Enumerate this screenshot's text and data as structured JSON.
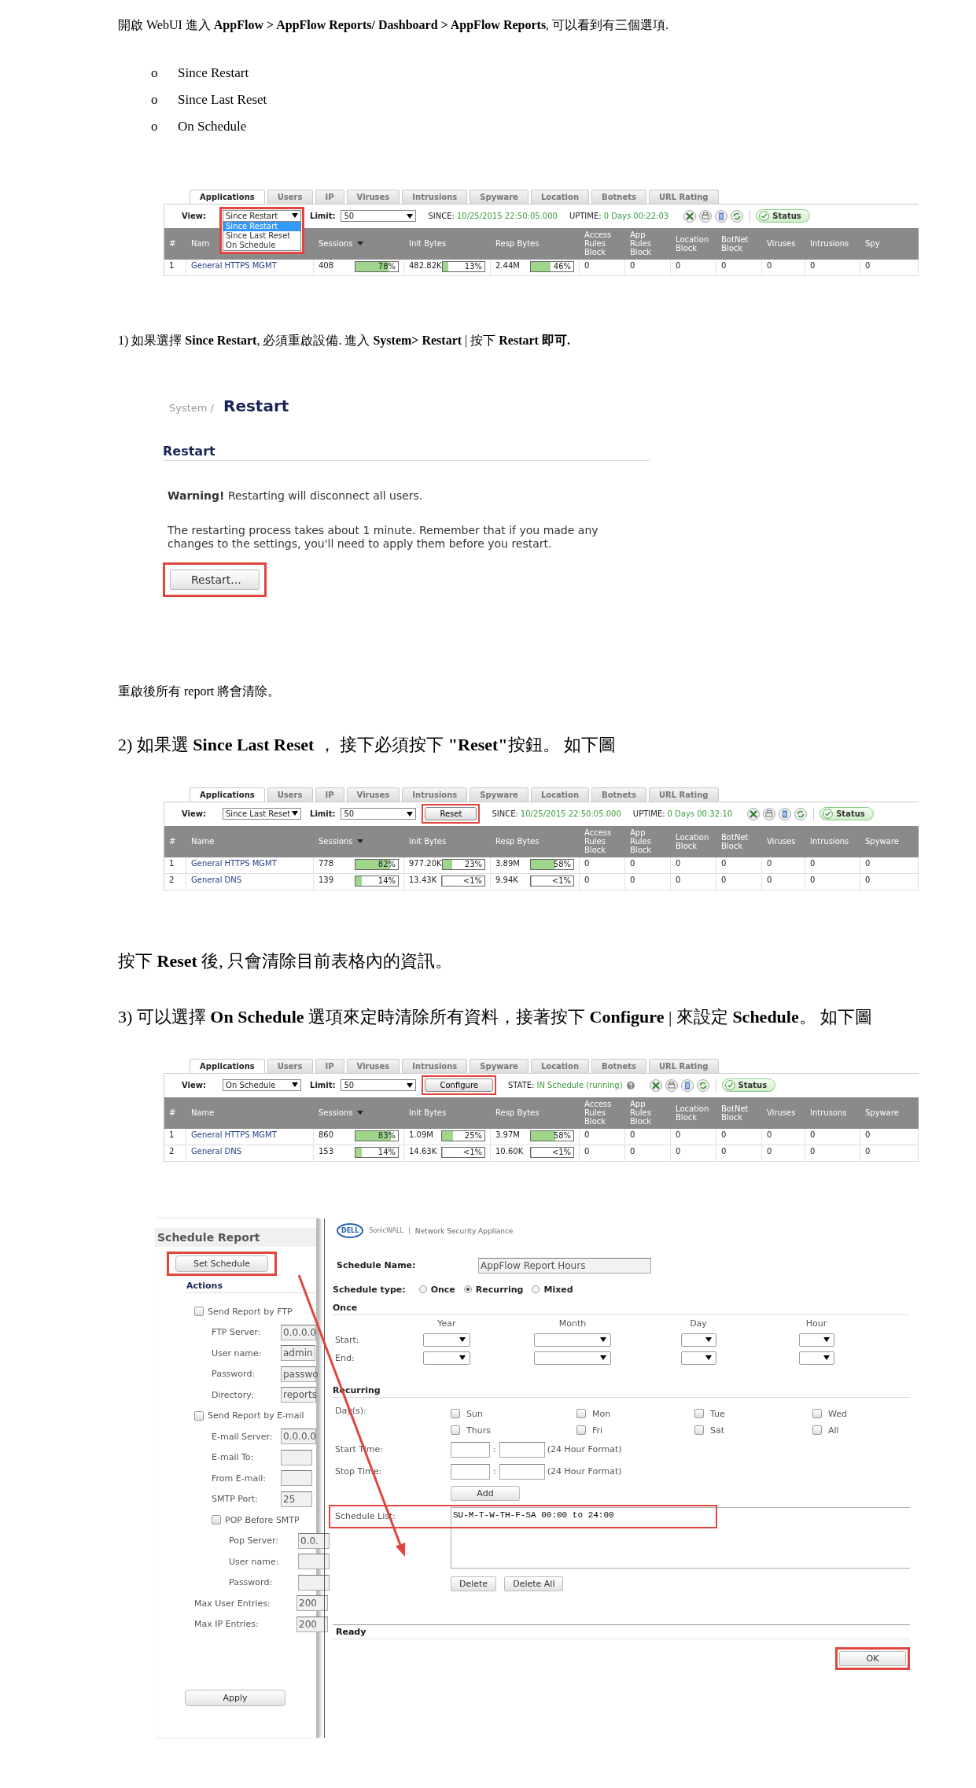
{
  "sections": [
    {
      "kind": "note",
      "text": "開啟 WebUI 進入 **AppFlow > AppFlow Reports/ Dashboard > AppFlow Reports**, 可以看到有三個選項."
    },
    {
      "kind": "bullets",
      "items": [
        {
          "marker": "o",
          "text": "Since Restart"
        },
        {
          "marker": "o",
          "text": "Since Last Reset"
        },
        {
          "marker": "o",
          "text": "On Schedule"
        }
      ]
    },
    {
      "kind": "report",
      "tabs": [
        {
          "label": "Applications",
          "selected": true
        },
        {
          "label": "Users",
          "selected": false
        },
        {
          "label": "IP",
          "selected": false
        },
        {
          "label": "Viruses",
          "selected": false
        },
        {
          "label": "Intrusions",
          "selected": false
        },
        {
          "label": "Spyware",
          "selected": false
        },
        {
          "label": "Location",
          "selected": false
        },
        {
          "label": "Botnets",
          "selected": false
        },
        {
          "label": "URL Rating",
          "selected": false
        }
      ],
      "view_label": "View:",
      "view_value": "Since Restart",
      "dropdown_open": true,
      "view_highlighted": true,
      "action_highlighted": false,
      "options": [
        {
          "label": "Since Restart",
          "selected": true
        },
        {
          "label": "Since Last Reset",
          "selected": false
        },
        {
          "label": "On Schedule",
          "selected": false
        }
      ],
      "limit_label": "Limit:",
      "limit_value": "50",
      "has_help": false,
      "status": [
        {
          "label": "SINCE:",
          "value": "10/25/2015 22:50:05.000"
        },
        {
          "label": "UPTIME:",
          "value": "0 Days 00:22:03"
        }
      ],
      "status_button": "Status",
      "columns": [
        "#",
        "Nam",
        "Sessions",
        "Init Bytes",
        "Resp Bytes",
        "Access Rules Block",
        "App Rules Block",
        "Location Block",
        "BotNet Block",
        "Viruses",
        "Intrusions",
        "Spy"
      ],
      "rows": [
        {
          "num": "1",
          "name": "General HTTPS MGMT",
          "bars": [
            {
              "value": "408",
              "percent": "78%",
              "level": 0.78
            },
            {
              "value": "482.82K",
              "percent": "13%",
              "level": 0.13
            },
            {
              "value": "2.44M",
              "percent": "46%",
              "level": 0.46
            }
          ],
          "rest": [
            "0",
            "0",
            "0",
            "0",
            "0",
            "0",
            "0"
          ]
        }
      ]
    },
    {
      "kind": "note",
      "text": "1) 如果選擇 **Since Restart**, 必須重啟設備.  進入 **System> Restart** |  按下 **Restart 即可.**"
    },
    {
      "kind": "restart_panel",
      "crumb": "System /",
      "title": "Restart",
      "section": "Restart",
      "warning": "**Warning!** Restarting will disconnect all users.",
      "body": "The restarting process takes about 1 minute. Remember that if you made any changes to the settings, you'll need to apply them before you restart.",
      "button": "Restart..."
    },
    {
      "kind": "note",
      "text": "重啟後所有 report 將會清除。"
    },
    {
      "kind": "step",
      "text": "2) 如果選 **Since Last Reset** ，  接下必須按下 **\"Reset\"**按鈕。  如下圖"
    },
    {
      "kind": "report",
      "tabs": [
        {
          "label": "Applications",
          "selected": true
        },
        {
          "label": "Users",
          "selected": false
        },
        {
          "label": "IP",
          "selected": false
        },
        {
          "label": "Viruses",
          "selected": false
        },
        {
          "label": "Intrusions",
          "selected": false
        },
        {
          "label": "Spyware",
          "selected": false
        },
        {
          "label": "Location",
          "selected": false
        },
        {
          "label": "Botnets",
          "selected": false
        },
        {
          "label": "URL Rating",
          "selected": false
        }
      ],
      "view_label": "View:",
      "view_value": "Since Last Reset",
      "dropdown_open": false,
      "view_highlighted": false,
      "action_highlighted": true,
      "action_button": "Reset",
      "limit_label": "Limit:",
      "limit_value": "50",
      "has_help": false,
      "status": [
        {
          "label": "SINCE:",
          "value": "10/25/2015 22:50:05.000"
        },
        {
          "label": "UPTIME:",
          "value": "0 Days 00:32:10"
        }
      ],
      "status_button": "Status",
      "columns": [
        "#",
        "Name",
        "Sessions",
        "Init Bytes",
        "Resp Bytes",
        "Access Rules Block",
        "App Rules Block",
        "Location Block",
        "BotNet Block",
        "Viruses",
        "Intrusions",
        "Spyware"
      ],
      "rows": [
        {
          "num": "1",
          "name": "General HTTPS MGMT",
          "bars": [
            {
              "value": "778",
              "percent": "82%",
              "level": 0.82
            },
            {
              "value": "977.20K",
              "percent": "23%",
              "level": 0.23
            },
            {
              "value": "3.89M",
              "percent": "58%",
              "level": 0.58
            }
          ],
          "rest": [
            "0",
            "0",
            "0",
            "0",
            "0",
            "0",
            "0"
          ]
        },
        {
          "num": "2",
          "name": "General DNS",
          "bars": [
            {
              "value": "139",
              "percent": "14%",
              "level": 0.14
            },
            {
              "value": "13.43K",
              "percent": "<1%",
              "level": 0.01
            },
            {
              "value": "9.94K",
              "percent": "<1%",
              "level": 0.01
            }
          ],
          "rest": [
            "0",
            "0",
            "0",
            "0",
            "0",
            "0",
            "0"
          ]
        }
      ]
    },
    {
      "kind": "step",
      "text": "按下 **Reset** 後, 只會清除目前表格內的資訊。"
    },
    {
      "kind": "step",
      "text": "3) 可以選擇 **On Schedule** 選項來定時清除所有資料，接著按下 **Configure** |  來設定 **Schedule**。 如下圖"
    },
    {
      "kind": "report",
      "tabs": [
        {
          "label": "Applications",
          "selected": true
        },
        {
          "label": "Users",
          "selected": false
        },
        {
          "label": "IP",
          "selected": false
        },
        {
          "label": "Viruses",
          "selected": false
        },
        {
          "label": "Intrusions",
          "selected": false
        },
        {
          "label": "Spyware",
          "selected": false
        },
        {
          "label": "Location",
          "selected": false
        },
        {
          "label": "Botnets",
          "selected": false
        },
        {
          "label": "URL Rating",
          "selected": false
        }
      ],
      "view_label": "View:",
      "view_value": "On Schedule",
      "dropdown_open": false,
      "view_highlighted": false,
      "action_highlighted": true,
      "action_button": "Configure",
      "limit_label": "Limit:",
      "limit_value": "50",
      "has_help": true,
      "status": [
        {
          "label": "STATE:",
          "value": "IN Schedule (running)"
        }
      ],
      "status_button": "Status",
      "columns": [
        "#",
        "Name",
        "Sessions",
        "Init Bytes",
        "Resp Bytes",
        "Access Rules Block",
        "App Rules Block",
        "Location Block",
        "BotNet Block",
        "Viruses",
        "Intrusons",
        "Spyware"
      ],
      "rows": [
        {
          "num": "1",
          "name": "General HTTPS MGMT",
          "bars": [
            {
              "value": "860",
              "percent": "83%",
              "level": 0.83
            },
            {
              "value": "1.09M",
              "percent": "25%",
              "level": 0.25
            },
            {
              "value": "3.97M",
              "percent": "58%",
              "level": 0.58
            }
          ],
          "rest": [
            "0",
            "0",
            "0",
            "0",
            "0",
            "0",
            "0"
          ]
        },
        {
          "num": "2",
          "name": "General DNS",
          "bars": [
            {
              "value": "153",
              "percent": "14%",
              "level": 0.14
            },
            {
              "value": "14.63K",
              "percent": "<1%",
              "level": 0.01
            },
            {
              "value": "10.60K",
              "percent": "<1%",
              "level": 0.01
            }
          ],
          "rest": [
            "0",
            "0",
            "0",
            "0",
            "0",
            "0",
            "0"
          ]
        }
      ]
    },
    {
      "kind": "schedule_dialog",
      "left": {
        "title": "Schedule Report",
        "button": "Set Schedule",
        "actions": "Actions",
        "apply": "Apply",
        "items": [
          {
            "kind": "checkbox",
            "label": "Send Report by FTP",
            "checked": false,
            "children": [
              {
                "kind": "field",
                "label": "FTP Server:",
                "value": "0.0.0.0"
              },
              {
                "kind": "field",
                "label": "User name:",
                "value": "admin"
              },
              {
                "kind": "field",
                "label": "Password:",
                "value": "passwo"
              },
              {
                "kind": "field",
                "label": "Directory:",
                "value": "reports"
              }
            ]
          },
          {
            "kind": "checkbox",
            "label": "Send Report by E-mail",
            "checked": false,
            "children": [
              {
                "kind": "field",
                "label": "E-mail Server:",
                "value": "0.0.0.0"
              },
              {
                "kind": "field",
                "label": "E-mail To:"
              },
              {
                "kind": "field",
                "label": "From E-mail:"
              },
              {
                "kind": "field",
                "label": "SMTP Port:",
                "value": "25"
              },
              {
                "kind": "checkbox",
                "label": "POP Before SMTP",
                "checked": false,
                "children": [
                  {
                    "kind": "field",
                    "label": "Pop Server:",
                    "value": "0.0."
                  },
                  {
                    "kind": "field",
                    "label": "User name:"
                  },
                  {
                    "kind": "field",
                    "label": "Password:"
                  }
                ]
              }
            ]
          },
          {
            "kind": "field",
            "label": "Max User Entries:",
            "value": "200"
          },
          {
            "kind": "field",
            "label": "Max IP Entries:",
            "value": "200"
          }
        ]
      },
      "brand": {
        "logo": "DELL",
        "product": "SonicWALL",
        "subtitle": "Network Security Appliance"
      },
      "name_label": "Schedule Name:",
      "name_value": "AppFlow Report Hours",
      "type_label": "Schedule type:",
      "types": [
        {
          "label": "Once",
          "selected": false
        },
        {
          "label": "Recurring",
          "selected": true
        },
        {
          "label": "Mixed",
          "selected": false
        }
      ],
      "once_title": "Once",
      "once_columns": [
        "Year",
        "Month",
        "Day",
        "Hour"
      ],
      "once_rows": [
        "Start:",
        "End:"
      ],
      "recurring_title": "Recurring",
      "days_label": "Day(s):",
      "days": [
        {
          "label": "Sun",
          "checked": false
        },
        {
          "label": "Mon",
          "checked": false
        },
        {
          "label": "Tue",
          "checked": false
        },
        {
          "label": "Wed",
          "checked": false
        },
        {
          "label": "Thurs",
          "checked": false
        },
        {
          "label": "Fri",
          "checked": false
        },
        {
          "label": "Sat",
          "checked": false
        },
        {
          "label": "All",
          "checked": false
        }
      ],
      "times": [
        {
          "label": "Start Time:",
          "separator": ":",
          "hint": "(24 Hour Format)"
        },
        {
          "label": "Stop Time:",
          "separator": ":",
          "hint": "(24 Hour Format)"
        }
      ],
      "add_button": "Add",
      "list_label": "Schedule List:",
      "list_entries": [
        "SU-M-T-W-TH-F-SA 00:00 to 24:00"
      ],
      "delete_buttons": [
        "Delete",
        "Delete All"
      ],
      "status": "Ready",
      "ok_button": "OK"
    }
  ]
}
